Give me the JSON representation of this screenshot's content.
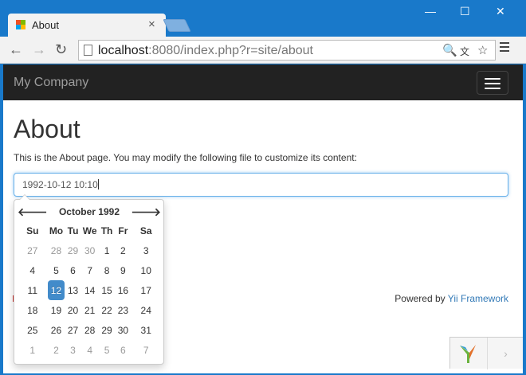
{
  "browser": {
    "tab_title": "About",
    "tab_close": "×",
    "url_host": "localhost",
    "url_rest": ":8080/index.php?r=site/about",
    "controls": {
      "minimize": "—",
      "maximize": "☐",
      "close": "✕"
    },
    "nav": {
      "back": "←",
      "forward": "→",
      "reload": "↻"
    }
  },
  "navbar": {
    "brand": "My Company"
  },
  "page": {
    "title": "About",
    "description": "This is the About page. You may modify the following file to customize its content:",
    "datetime_value": "1992-10-12 10:10"
  },
  "datepicker": {
    "month_label": "October 1992",
    "prev": "🡐",
    "next": "🡒",
    "weekdays": [
      "Su",
      "Mo",
      "Tu",
      "We",
      "Th",
      "Fr",
      "Sa"
    ],
    "weeks": [
      [
        {
          "d": "27",
          "c": "old"
        },
        {
          "d": "28",
          "c": "old"
        },
        {
          "d": "29",
          "c": "old"
        },
        {
          "d": "30",
          "c": "old"
        },
        {
          "d": "1"
        },
        {
          "d": "2"
        },
        {
          "d": "3"
        }
      ],
      [
        {
          "d": "4"
        },
        {
          "d": "5"
        },
        {
          "d": "6"
        },
        {
          "d": "7"
        },
        {
          "d": "8"
        },
        {
          "d": "9"
        },
        {
          "d": "10"
        }
      ],
      [
        {
          "d": "11"
        },
        {
          "d": "12",
          "c": "active"
        },
        {
          "d": "13"
        },
        {
          "d": "14"
        },
        {
          "d": "15"
        },
        {
          "d": "16"
        },
        {
          "d": "17"
        }
      ],
      [
        {
          "d": "18"
        },
        {
          "d": "19"
        },
        {
          "d": "20"
        },
        {
          "d": "21"
        },
        {
          "d": "22"
        },
        {
          "d": "23"
        },
        {
          "d": "24"
        }
      ],
      [
        {
          "d": "25"
        },
        {
          "d": "26"
        },
        {
          "d": "27"
        },
        {
          "d": "28"
        },
        {
          "d": "29"
        },
        {
          "d": "30"
        },
        {
          "d": "31"
        }
      ],
      [
        {
          "d": "1",
          "c": "new"
        },
        {
          "d": "2",
          "c": "new"
        },
        {
          "d": "3",
          "c": "new"
        },
        {
          "d": "4",
          "c": "new"
        },
        {
          "d": "5",
          "c": "new"
        },
        {
          "d": "6",
          "c": "new"
        },
        {
          "d": "7",
          "c": "new"
        }
      ]
    ]
  },
  "footer": {
    "powered_by": "Powered by ",
    "link": "Yii Framework"
  },
  "debug": {
    "expand": "›"
  },
  "colors": {
    "accent": "#428bca",
    "navbar": "#222222",
    "link": "#337ab7"
  }
}
